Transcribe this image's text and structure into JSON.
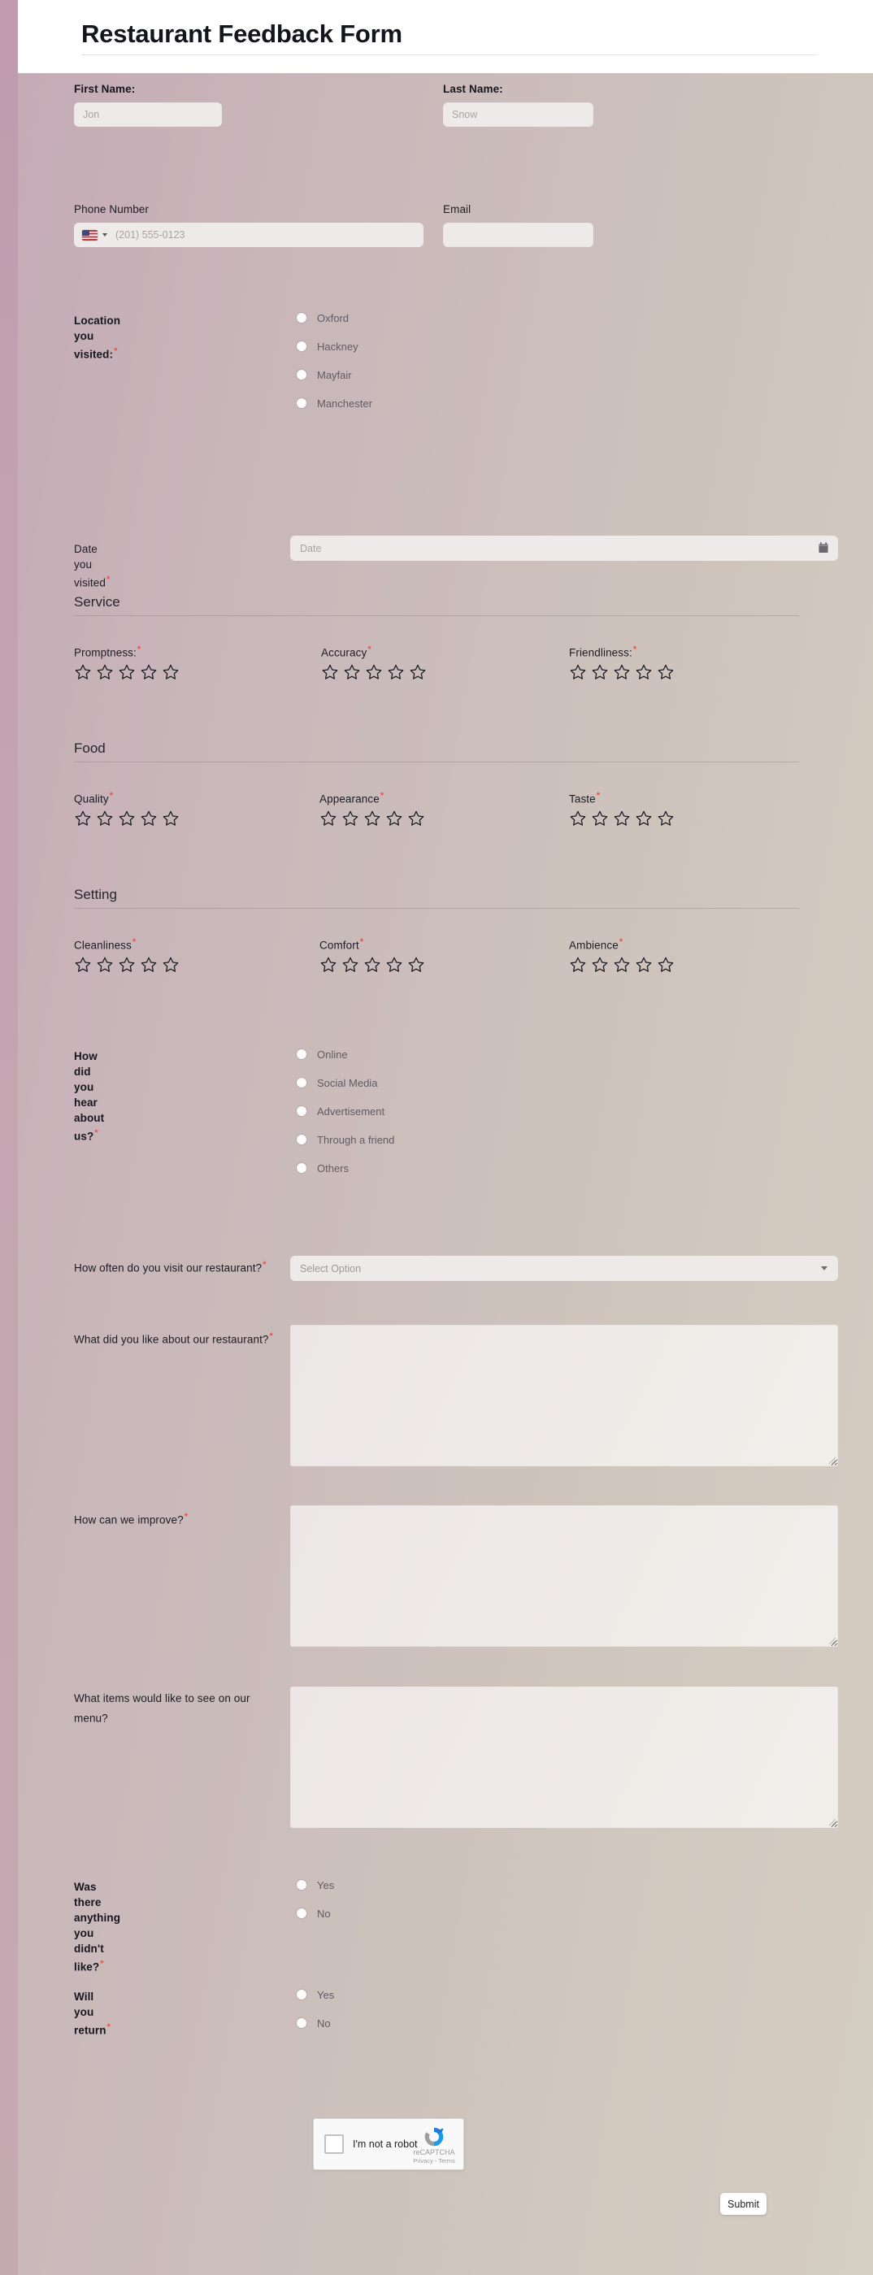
{
  "header": {
    "title": "Restaurant Feedback Form"
  },
  "theme": {
    "background_left": "#c4a9b4",
    "background_right": "#d5cec2",
    "header_bg": "#ffffff",
    "input_bg": "#eeeae9",
    "required_marker_color": "#e8534c",
    "label_color": "#16161e",
    "radio_label_color": "#605c63",
    "submit_bg": "#ffffff"
  },
  "fields": {
    "first_name": {
      "label": "First Name:",
      "placeholder": "Jon",
      "value": ""
    },
    "last_name": {
      "label": "Last Name:",
      "placeholder": "Snow",
      "value": ""
    },
    "phone": {
      "label": "Phone Number",
      "placeholder": "(201) 555-0123",
      "value": "",
      "country_flag": "us-flag-icon",
      "country_caret": "chevron-down-icon"
    },
    "email": {
      "label": "Email",
      "placeholder": "",
      "value": ""
    },
    "location": {
      "label": "Location you visited:",
      "required": "*",
      "options": [
        "Oxford",
        "Hackney",
        "Mayfair",
        "Manchester"
      ],
      "selected": ""
    },
    "date_visited": {
      "label": "Date you visited",
      "required": "*",
      "placeholder": "Date",
      "value": "",
      "icon": "calendar-icon"
    },
    "hear_about": {
      "label": "How did you hear about us?",
      "required": "*",
      "options": [
        "Online",
        "Social Media",
        "Advertisement",
        "Through a friend",
        "Others"
      ],
      "selected": ""
    },
    "visit_frequency": {
      "label": "How often do you visit our restaurant?",
      "required": "*",
      "value": "Select Option",
      "caret": "chevron-down-icon"
    },
    "liked": {
      "label": "What did you like about our restaurant?",
      "required": "*",
      "value": ""
    },
    "improve": {
      "label": "How can we improve?",
      "required": "*",
      "value": ""
    },
    "menu_items": {
      "label": "What items would like to see on our menu?",
      "required": "",
      "value": ""
    },
    "disliked": {
      "label": "Was there anything you didn't like?",
      "required": "*",
      "options": [
        "Yes",
        "No"
      ],
      "selected": ""
    },
    "will_return": {
      "label": "Will you return",
      "required": "*",
      "options": [
        "Yes",
        "No"
      ],
      "selected": ""
    }
  },
  "sections": [
    {
      "title": "Service",
      "ratings": [
        {
          "label": "Promptness:",
          "required": "*",
          "stars": 5,
          "value": 0
        },
        {
          "label": "Accuracy",
          "required": "*",
          "stars": 5,
          "value": 0
        },
        {
          "label": "Friendliness:",
          "required": "*",
          "stars": 5,
          "value": 0
        }
      ]
    },
    {
      "title": "Food",
      "ratings": [
        {
          "label": "Quality",
          "required": "*",
          "stars": 5,
          "value": 0
        },
        {
          "label": "Appearance",
          "required": "*",
          "stars": 5,
          "value": 0
        },
        {
          "label": "Taste",
          "required": "*",
          "stars": 5,
          "value": 0
        }
      ]
    },
    {
      "title": "Setting",
      "ratings": [
        {
          "label": "Cleanliness",
          "required": "*",
          "stars": 5,
          "value": 0
        },
        {
          "label": "Comfort",
          "required": "*",
          "stars": 5,
          "value": 0
        },
        {
          "label": "Ambience",
          "required": "*",
          "stars": 5,
          "value": 0
        }
      ]
    }
  ],
  "recaptcha": {
    "checkbox_label": "I'm not a robot",
    "brand": "reCAPTCHA",
    "links": "Privacy - Terms",
    "checked": false
  },
  "submit": {
    "label": "Submit"
  }
}
